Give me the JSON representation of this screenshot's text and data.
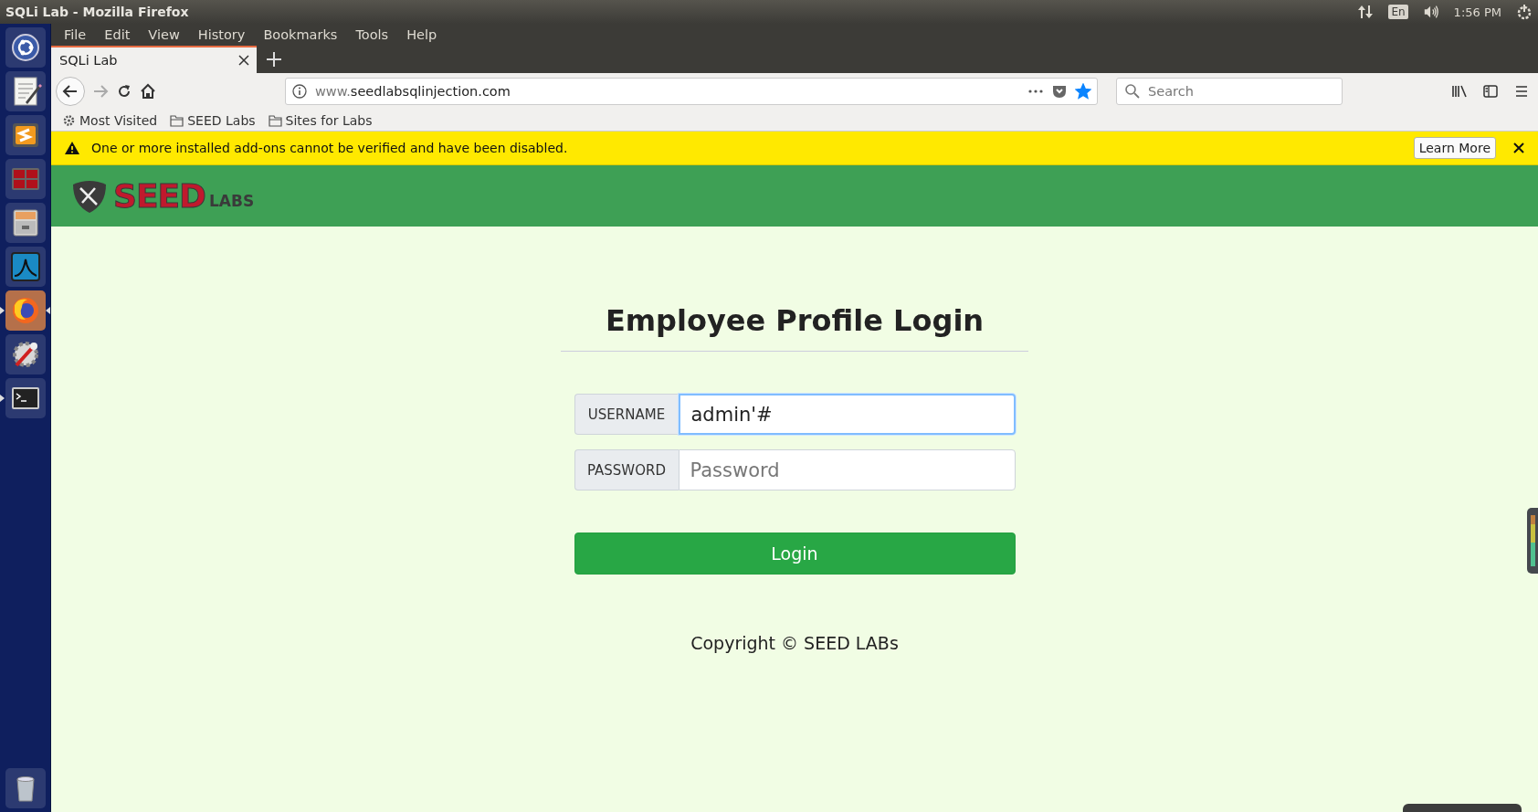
{
  "top_panel": {
    "title": "SQLi Lab - Mozilla Firefox",
    "keyboard": "En",
    "time": "1:56 PM"
  },
  "launcher": [
    {
      "kind": "dash",
      "running": false,
      "focused": false
    },
    {
      "kind": "editor",
      "running": false,
      "focused": false
    },
    {
      "kind": "sublime",
      "running": false,
      "focused": false
    },
    {
      "kind": "terminals",
      "running": false,
      "focused": false
    },
    {
      "kind": "files",
      "running": false,
      "focused": false
    },
    {
      "kind": "wireshark",
      "running": false,
      "focused": false
    },
    {
      "kind": "firefox",
      "running": true,
      "focused": true
    },
    {
      "kind": "settings",
      "running": false,
      "focused": false
    },
    {
      "kind": "terminal",
      "running": true,
      "focused": false
    },
    {
      "kind": "trash",
      "running": false,
      "focused": false
    }
  ],
  "menu": [
    "File",
    "Edit",
    "View",
    "History",
    "Bookmarks",
    "Tools",
    "Help"
  ],
  "tabs": [
    {
      "label": "SQLi Lab",
      "selected": true
    }
  ],
  "address": {
    "prefix": "www.",
    "host": "seedlabsqlinjection.com",
    "bookmarked": true
  },
  "search": {
    "placeholder": "Search"
  },
  "bookmarks": [
    {
      "kind": "gear",
      "label": "Most Visited"
    },
    {
      "kind": "folder",
      "label": "SEED Labs"
    },
    {
      "kind": "folder",
      "label": "Sites for Labs"
    }
  ],
  "notification": {
    "message": "One or more installed add-ons cannot be verified and have been disabled.",
    "button": "Learn More"
  },
  "page": {
    "logo": {
      "mark": "SEED",
      "suffix": "LABS"
    },
    "heading": "Employee Profile Login",
    "fields": [
      {
        "label": "USERNAME",
        "value": "admin'#",
        "focused": true
      },
      {
        "label": "PASSWORD",
        "placeholder": "Password",
        "focused": false
      }
    ],
    "button": "Login",
    "footer": "Copyright © SEED LABs"
  }
}
